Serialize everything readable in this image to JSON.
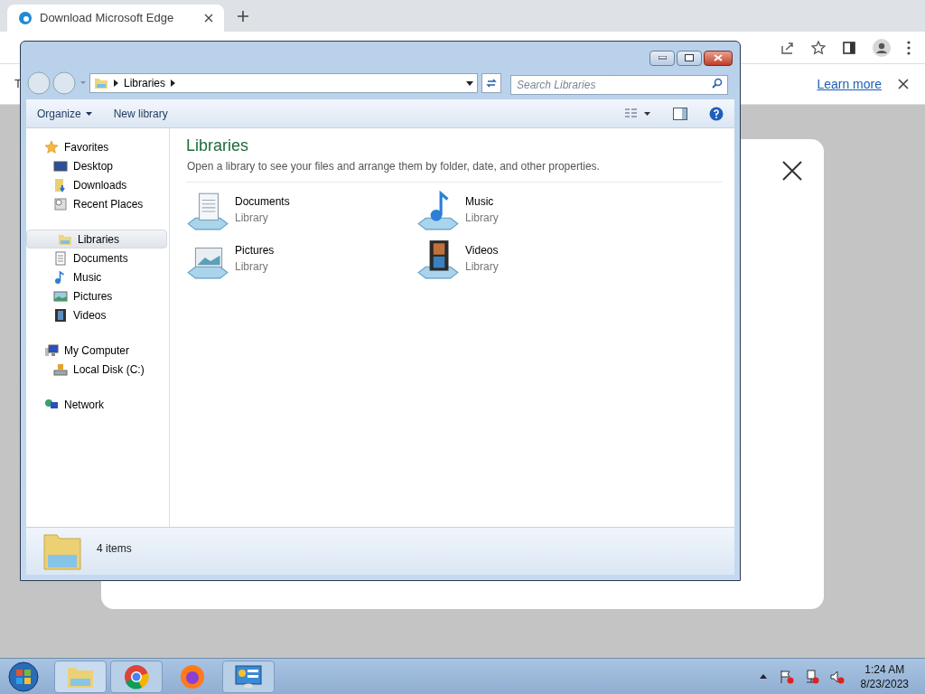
{
  "browser": {
    "tab": {
      "title": "Download Microsoft Edge",
      "selected": true
    },
    "info_bar": {
      "cut_text": "T",
      "link": "Learn more"
    }
  },
  "explorer": {
    "address": [
      "Libraries"
    ],
    "search": {
      "placeholder": "Search Libraries"
    },
    "toolbar": [
      "Organize",
      "New library"
    ],
    "nav": [
      {
        "label": "Favorites",
        "kind": "star",
        "selected": false,
        "children": [
          {
            "label": "Desktop",
            "kind": "desktop",
            "selected": false
          },
          {
            "label": "Downloads",
            "kind": "downloads",
            "selected": false
          },
          {
            "label": "Recent Places",
            "kind": "recent",
            "selected": false
          }
        ]
      },
      {
        "label": "Libraries",
        "kind": "libraries",
        "selected": true,
        "children": [
          {
            "label": "Documents",
            "kind": "documents",
            "selected": false
          },
          {
            "label": "Music",
            "kind": "music",
            "selected": false
          },
          {
            "label": "Pictures",
            "kind": "pictures",
            "selected": false
          },
          {
            "label": "Videos",
            "kind": "videos",
            "selected": false
          }
        ]
      },
      {
        "label": "My Computer",
        "kind": "computer",
        "selected": false,
        "children": [
          {
            "label": "Local Disk (C:)",
            "kind": "disk",
            "selected": false
          }
        ]
      },
      {
        "label": "Network",
        "kind": "network",
        "selected": false
      }
    ],
    "title": "Libraries",
    "subtitle": "Open a library to see your files and arrange them by folder, date, and other properties.",
    "items": [
      {
        "name": "Documents",
        "type": "Library",
        "kind": "documents"
      },
      {
        "name": "Music",
        "type": "Library",
        "kind": "music"
      },
      {
        "name": "Pictures",
        "type": "Library",
        "kind": "pictures"
      },
      {
        "name": "Videos",
        "type": "Library",
        "kind": "videos"
      }
    ],
    "status": "4 items"
  },
  "taskbar": {
    "time": "1:24 AM",
    "date": "8/23/2023"
  }
}
